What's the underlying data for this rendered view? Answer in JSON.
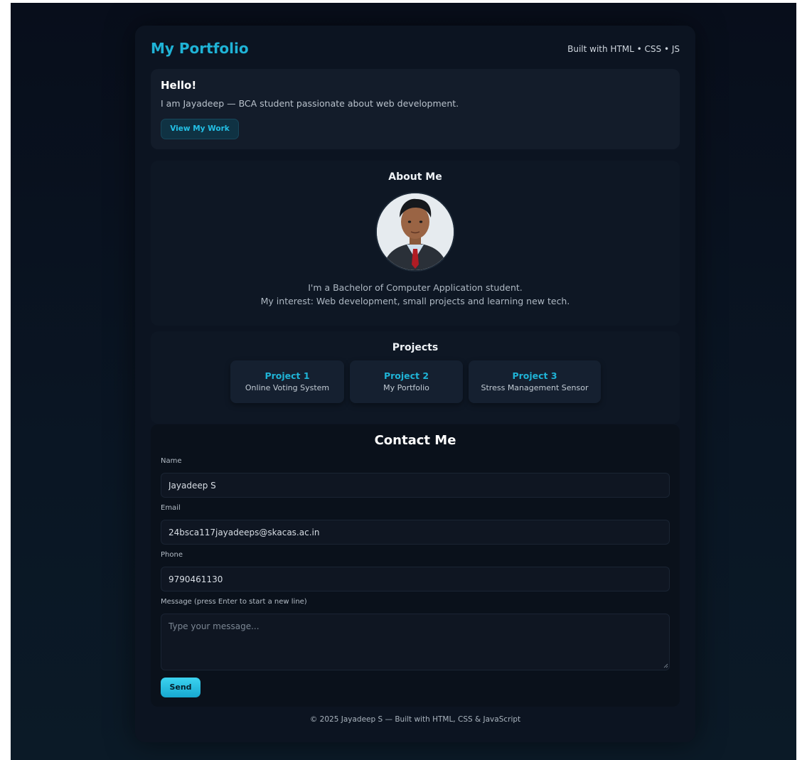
{
  "header": {
    "site_title": "My Portfolio",
    "tech_note": "Built with HTML • CSS • JS"
  },
  "hero": {
    "greeting": "Hello!",
    "intro": "I am Jayadeep — BCA student passionate about web development.",
    "cta_label": "View My Work"
  },
  "about": {
    "title": "About Me",
    "avatar_icon": "profile-photo",
    "line1": "I'm a Bachelor of Computer Application student.",
    "line2": "My interest: Web development, small projects and learning new tech."
  },
  "projects": {
    "title": "Projects",
    "items": [
      {
        "name": "Project 1",
        "desc": "Online Voting System"
      },
      {
        "name": "Project 2",
        "desc": "My Portfolio"
      },
      {
        "name": "Project 3",
        "desc": "Stress Management Sensor"
      }
    ]
  },
  "contact": {
    "title": "Contact Me",
    "name_label": "Name",
    "name_value": "Jayadeep S",
    "email_label": "Email",
    "email_value": "24bsca117jayadeeps@skacas.ac.in",
    "phone_label": "Phone",
    "phone_value": "9790461130",
    "message_label": "Message (press Enter to start a new line)",
    "message_placeholder": "Type your message...",
    "send_label": "Send"
  },
  "footer": {
    "text": "© 2025 Jayadeep S — Built with HTML, CSS & JavaScript"
  },
  "colors": {
    "accent": "#1fb3d6",
    "background": "#0c1421",
    "send_button": "#2bc4e6"
  }
}
